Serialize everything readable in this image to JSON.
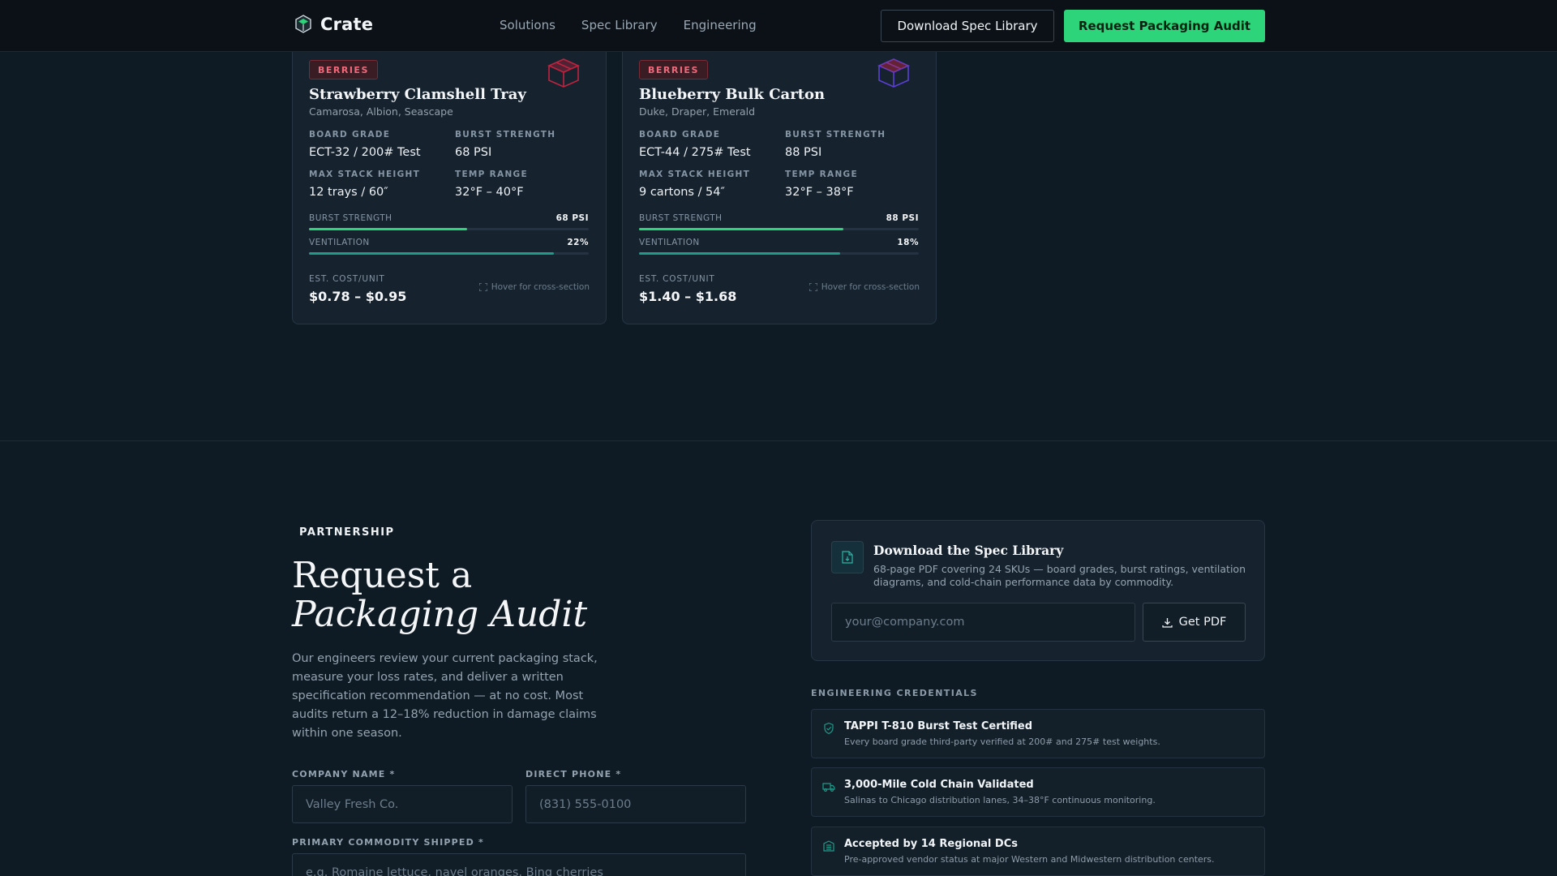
{
  "nav": {
    "brand": "Crate",
    "links": [
      "Solutions",
      "Spec Library",
      "Engineering"
    ],
    "download_btn": "Download Spec Library",
    "audit_btn": "Request Packaging Audit"
  },
  "cards": [
    {
      "badge": "BERRIES",
      "title": "Strawberry Clamshell Tray",
      "varieties": "Camarosa, Albion, Seascape",
      "icon": "box-icon",
      "icon_color": "#c0233f",
      "specs": [
        {
          "label": "BOARD GRADE",
          "value": "ECT-32 / 200# Test"
        },
        {
          "label": "BURST STRENGTH",
          "value": "68 PSI"
        },
        {
          "label": "MAX STACK HEIGHT",
          "value": "12 trays / 60″"
        },
        {
          "label": "TEMP RANGE",
          "value": "32°F – 40°F"
        }
      ],
      "bars": [
        {
          "label": "BURST STRENGTH",
          "value_text": "68 PSI",
          "fill": 0.565
        },
        {
          "label": "VENTILATION",
          "value_text": "22%",
          "fill": 0.875
        }
      ],
      "cost_label": "EST. COST/UNIT",
      "cost": "$0.78 – $0.95",
      "hint": "Hover for cross-section"
    },
    {
      "badge": "BERRIES",
      "title": "Blueberry Bulk Carton",
      "varieties": "Duke, Draper, Emerald",
      "icon": "box-icon",
      "icon_color": "#5b3fd6",
      "specs": [
        {
          "label": "BOARD GRADE",
          "value": "ECT-44 / 275# Test"
        },
        {
          "label": "BURST STRENGTH",
          "value": "88 PSI"
        },
        {
          "label": "MAX STACK HEIGHT",
          "value": "9 cartons / 54″"
        },
        {
          "label": "TEMP RANGE",
          "value": "32°F – 38°F"
        }
      ],
      "bars": [
        {
          "label": "BURST STRENGTH",
          "value_text": "88 PSI",
          "fill": 0.73
        },
        {
          "label": "VENTILATION",
          "value_text": "18%",
          "fill": 0.72
        }
      ],
      "cost_label": "EST. COST/UNIT",
      "cost": "$1.40 – $1.68",
      "hint": "Hover for cross-section"
    }
  ],
  "audit": {
    "eyebrow": "PARTNERSHIP",
    "headline_line1": "Request a",
    "headline_line2": "Packaging Audit",
    "lead": "Our engineers review your current packaging stack, measure your loss rates, and deliver a written specification recommendation — at no cost. Most audits return a 12–18% reduction in damage claims within one season.",
    "company_label": "COMPANY NAME *",
    "company_placeholder": "Valley Fresh Co.",
    "phone_label": "DIRECT PHONE *",
    "phone_placeholder": "(831) 555-0100",
    "commodity_label": "PRIMARY COMMODITY SHIPPED *",
    "commodity_placeholder": "e.g. Romaine lettuce, navel oranges, Bing cherries"
  },
  "spec_library": {
    "title": "Download the Spec Library",
    "description": "68-page PDF covering 24 SKUs — board grades, burst ratings, ventilation diagrams, and cold-chain performance data by commodity.",
    "email_placeholder": "your@company.com",
    "button": "Get PDF"
  },
  "credentials": {
    "heading": "ENGINEERING CREDENTIALS",
    "items": [
      {
        "icon": "shield-icon",
        "title": "TAPPI T-810 Burst Test Certified",
        "desc": "Every board grade third-party verified at 200# and 275# test weights."
      },
      {
        "icon": "truck-icon",
        "title": "3,000-Mile Cold Chain Validated",
        "desc": "Salinas to Chicago distribution lanes, 34–38°F continuous monitoring."
      },
      {
        "icon": "building-icon",
        "title": "Accepted by 14 Regional DCs",
        "desc": "Pre-approved vendor status at major Western and Midwestern distribution centers."
      }
    ]
  },
  "colors": {
    "accent_green": "#2ed47a",
    "background": "#0f1b24",
    "card": "#16232f",
    "badge_red": "#f06a7b"
  }
}
